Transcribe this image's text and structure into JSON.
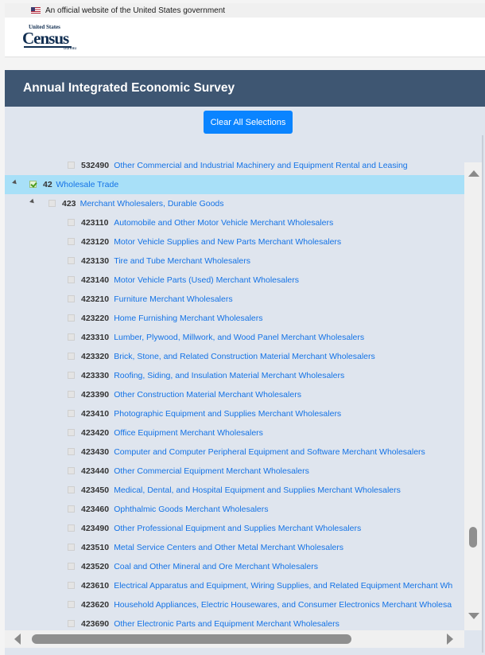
{
  "gov_banner": {
    "text": "An official website of the United States government"
  },
  "logo": {
    "top": "United States",
    "word": "Census",
    "bottom": "Bureau"
  },
  "page_title": "Annual Integrated Economic Survey",
  "clear_button": "Clear All Selections",
  "tree": [
    {
      "code": "532490",
      "name": "Other Commercial and Industrial Machinery and Equipment Rental and Leasing",
      "level": 2,
      "checked": false,
      "selected": false,
      "expander": false
    },
    {
      "code": "42",
      "name": "Wholesale Trade",
      "level": 0,
      "checked": true,
      "selected": true,
      "expander": true
    },
    {
      "code": "423",
      "name": "Merchant Wholesalers, Durable Goods",
      "level": 1,
      "checked": false,
      "selected": false,
      "expander": true
    },
    {
      "code": "423110",
      "name": "Automobile and Other Motor Vehicle Merchant Wholesalers",
      "level": 2,
      "checked": false,
      "selected": false,
      "expander": false
    },
    {
      "code": "423120",
      "name": "Motor Vehicle Supplies and New Parts Merchant Wholesalers",
      "level": 2,
      "checked": false,
      "selected": false,
      "expander": false
    },
    {
      "code": "423130",
      "name": "Tire and Tube Merchant Wholesalers",
      "level": 2,
      "checked": false,
      "selected": false,
      "expander": false
    },
    {
      "code": "423140",
      "name": "Motor Vehicle Parts (Used) Merchant Wholesalers",
      "level": 2,
      "checked": false,
      "selected": false,
      "expander": false
    },
    {
      "code": "423210",
      "name": "Furniture Merchant Wholesalers",
      "level": 2,
      "checked": false,
      "selected": false,
      "expander": false
    },
    {
      "code": "423220",
      "name": "Home Furnishing Merchant Wholesalers",
      "level": 2,
      "checked": false,
      "selected": false,
      "expander": false
    },
    {
      "code": "423310",
      "name": "Lumber, Plywood, Millwork, and Wood Panel Merchant Wholesalers",
      "level": 2,
      "checked": false,
      "selected": false,
      "expander": false
    },
    {
      "code": "423320",
      "name": "Brick, Stone, and Related Construction Material Merchant Wholesalers",
      "level": 2,
      "checked": false,
      "selected": false,
      "expander": false
    },
    {
      "code": "423330",
      "name": "Roofing, Siding, and Insulation Material Merchant Wholesalers",
      "level": 2,
      "checked": false,
      "selected": false,
      "expander": false
    },
    {
      "code": "423390",
      "name": "Other Construction Material Merchant Wholesalers",
      "level": 2,
      "checked": false,
      "selected": false,
      "expander": false
    },
    {
      "code": "423410",
      "name": "Photographic Equipment and Supplies Merchant Wholesalers",
      "level": 2,
      "checked": false,
      "selected": false,
      "expander": false
    },
    {
      "code": "423420",
      "name": "Office Equipment Merchant Wholesalers",
      "level": 2,
      "checked": false,
      "selected": false,
      "expander": false
    },
    {
      "code": "423430",
      "name": "Computer and Computer Peripheral Equipment and Software Merchant Wholesalers",
      "level": 2,
      "checked": false,
      "selected": false,
      "expander": false
    },
    {
      "code": "423440",
      "name": "Other Commercial Equipment Merchant Wholesalers",
      "level": 2,
      "checked": false,
      "selected": false,
      "expander": false
    },
    {
      "code": "423450",
      "name": "Medical, Dental, and Hospital Equipment and Supplies Merchant Wholesalers",
      "level": 2,
      "checked": false,
      "selected": false,
      "expander": false
    },
    {
      "code": "423460",
      "name": "Ophthalmic Goods Merchant Wholesalers",
      "level": 2,
      "checked": false,
      "selected": false,
      "expander": false
    },
    {
      "code": "423490",
      "name": "Other Professional Equipment and Supplies Merchant Wholesalers",
      "level": 2,
      "checked": false,
      "selected": false,
      "expander": false
    },
    {
      "code": "423510",
      "name": "Metal Service Centers and Other Metal Merchant Wholesalers",
      "level": 2,
      "checked": false,
      "selected": false,
      "expander": false
    },
    {
      "code": "423520",
      "name": "Coal and Other Mineral and Ore Merchant Wholesalers",
      "level": 2,
      "checked": false,
      "selected": false,
      "expander": false
    },
    {
      "code": "423610",
      "name": "Electrical Apparatus and Equipment, Wiring Supplies, and Related Equipment Merchant Wh",
      "level": 2,
      "checked": false,
      "selected": false,
      "expander": false
    },
    {
      "code": "423620",
      "name": "Household Appliances, Electric Housewares, and Consumer Electronics Merchant Wholesa",
      "level": 2,
      "checked": false,
      "selected": false,
      "expander": false
    },
    {
      "code": "423690",
      "name": "Other Electronic Parts and Equipment Merchant Wholesalers",
      "level": 2,
      "checked": false,
      "selected": false,
      "expander": false
    }
  ],
  "colors": {
    "title_bar": "#3e5672",
    "button": "#0a84ff",
    "link": "#1473e6",
    "selected_row": "#a8e0f8",
    "panel": "#dfe5ee"
  }
}
